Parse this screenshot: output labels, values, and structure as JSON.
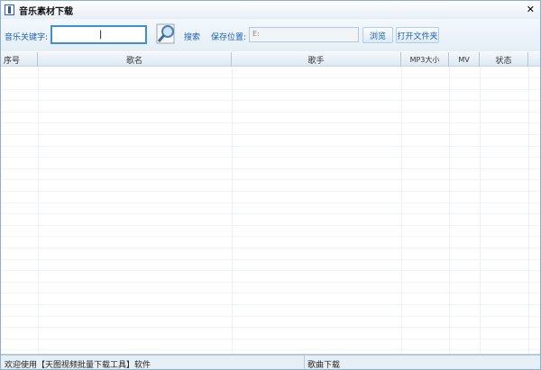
{
  "window": {
    "title": "音乐素材下载",
    "close": "✕"
  },
  "toolbar": {
    "keyword_label": "音乐关键字:",
    "keyword_value": "|",
    "search_label": "搜索",
    "save_label": "保存位置:",
    "save_path": "E:",
    "browse": "浏览",
    "open_folder": "打开文件夹"
  },
  "table": {
    "columns": [
      "序号",
      "歌名",
      "歌手",
      "MP3大小",
      "MV",
      "状态"
    ],
    "rows": []
  },
  "status": {
    "left": "欢迎使用【天图视频批量下载工具】软件",
    "right": "歌曲下载"
  }
}
